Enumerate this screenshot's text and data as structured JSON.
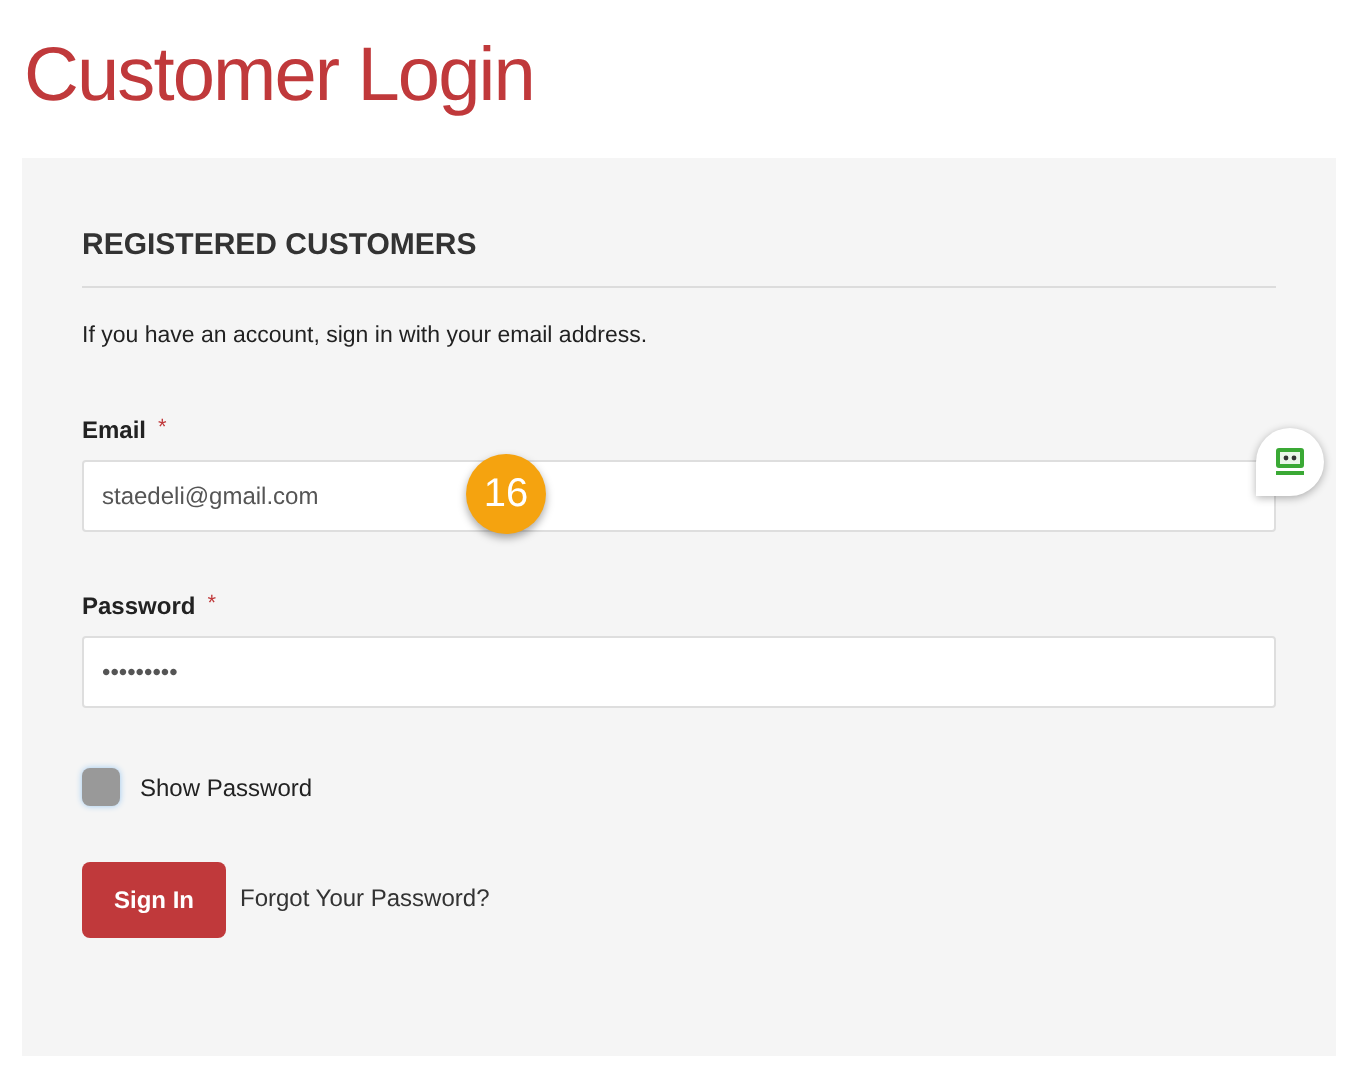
{
  "title": "Customer Login",
  "section": {
    "heading": "REGISTERED CUSTOMERS",
    "intro": "If you have an account, sign in with your email address."
  },
  "fields": [
    {
      "label": "Email",
      "required_mark": "*",
      "value": "staedeli@gmail.com",
      "badge": "16"
    },
    {
      "label": "Password",
      "required_mark": "*",
      "value": "•••••••••"
    }
  ],
  "show_password": {
    "label": "Show Password",
    "checked": false
  },
  "sign_in_button": "Sign In",
  "forgot_link": "Forgot Your Password?"
}
